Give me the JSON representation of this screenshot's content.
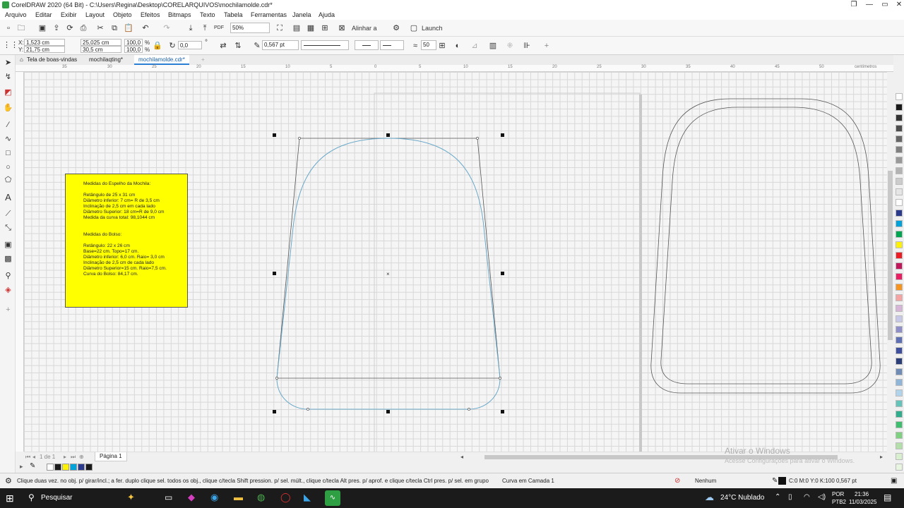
{
  "window": {
    "title": "CorelDRAW 2020 (64 Bit) - C:\\Users\\Regina\\Desktop\\CORELARQUIVOS\\mochilamolde.cdr*",
    "controls": [
      "❐",
      "—",
      "▭",
      "✕"
    ]
  },
  "menu": [
    "Arquivo",
    "Editar",
    "Exibir",
    "Layout",
    "Objeto",
    "Efeitos",
    "Bitmaps",
    "Texto",
    "Tabela",
    "Ferramentas",
    "Janela",
    "Ajuda"
  ],
  "toolbar1": {
    "zoom": "50%",
    "align_label": "Alinhar a",
    "launch_label": "Launch"
  },
  "toolbar2": {
    "x": "1,523 cm",
    "y": "21,75 cm",
    "x_label": "X:",
    "y_label": "Y:",
    "width": "25,025 cm",
    "height": "30,5 cm",
    "scale_w": "100,0",
    "scale_h": "100,0",
    "pct": "%",
    "rotation": "0,0",
    "degree": "°",
    "outline_width": "0,567 pt",
    "smoothness": "50"
  },
  "tabs": [
    "Tela de boas-vindas",
    "mochilaqting*",
    "mochilamolde.cdr*"
  ],
  "ruler_numbers": [
    "35",
    "30",
    "25",
    "20",
    "15",
    "10",
    "5",
    "0",
    "5",
    "10",
    "15",
    "20",
    "25",
    "30",
    "35",
    "40",
    "45",
    "50"
  ],
  "ruler_unit": "centímetros",
  "notes": {
    "lines": [
      "Medidas do Espelho da Mochila:",
      "",
      "Retângulo de 25 x 31 cm",
      "Diâmetro inferior: 7 cm= R de 3,5 cm",
      "Inclinação de 2,5 cm em cada lado",
      "Diâmetro Superior: 18 cm=R de 9,0 cm",
      "Medida da curva total: 98,1044 cm",
      "",
      "",
      "Medidas do Bolso:",
      "",
      "Retângulo: 22 x 26 cm",
      "Base=22 cm. Topo=17 cm.",
      "Diâmetro inferior: 6,0 cm. Raio= 3,0 cm",
      "Inclinação de 2,5 cm de cada lado",
      "Diâmetro Superior=15 cm. Raio=7,5 cm.",
      "Curva do Bolso: 84,17 cm."
    ]
  },
  "pagebar": {
    "page_of": "1 de 1",
    "page_tab": "Página 1"
  },
  "palette_colors": [
    "#ffffff",
    "#1a1a1a",
    "#333333",
    "#4d4d4d",
    "#666666",
    "#808080",
    "#999999",
    "#b3b3b3",
    "#cccccc",
    "#e6e6e6",
    "#ffffff",
    "#2b3a8c",
    "#00a3d9",
    "#00a650",
    "#fff200",
    "#ed1c24",
    "#c2185b",
    "#e91e63",
    "#f7941d",
    "#f5a3a3",
    "#d7b5d8",
    "#c8c8e8",
    "#8e8ec8",
    "#5e6fb5",
    "#3d4f9e",
    "#2c3e7a",
    "#6e8cb5",
    "#8fb5d9",
    "#b0d4ec",
    "#63c4b9",
    "#2fae8e",
    "#3dbf6f",
    "#7ed17e",
    "#b2e0a8",
    "#d8f0cf",
    "#e8f5e0"
  ],
  "bottom_palette": [
    "#ffffff",
    "#1a1a1a",
    "#fff200",
    "#00a3d9",
    "#2b3a8c",
    "#1a1a1a"
  ],
  "status": {
    "hint": "Clique duas vez. no obj. p/ girar/incl.; a fer. duplo clique sel. todos os obj., clique c/tecla Shift pression. p/ sel. múlt., clique c/tecla Alt pres. p/ aprof. e clique c/tecla Ctrl pres. p/ sel. em grupo",
    "object": "Curva em Camada 1",
    "fill": "Nenhum",
    "outline": "C:0 M:0 Y:0 K:100  0,567 pt"
  },
  "watermark": {
    "line1": "Ativar o Windows",
    "line2": "Acesse Configurações para ativar o Windows."
  },
  "taskbar": {
    "search": "Pesquisar",
    "weather": "24°C  Nublado",
    "lang1": "POR",
    "lang2": "PTB2",
    "time": "21:36",
    "date": "11/03/2025"
  }
}
